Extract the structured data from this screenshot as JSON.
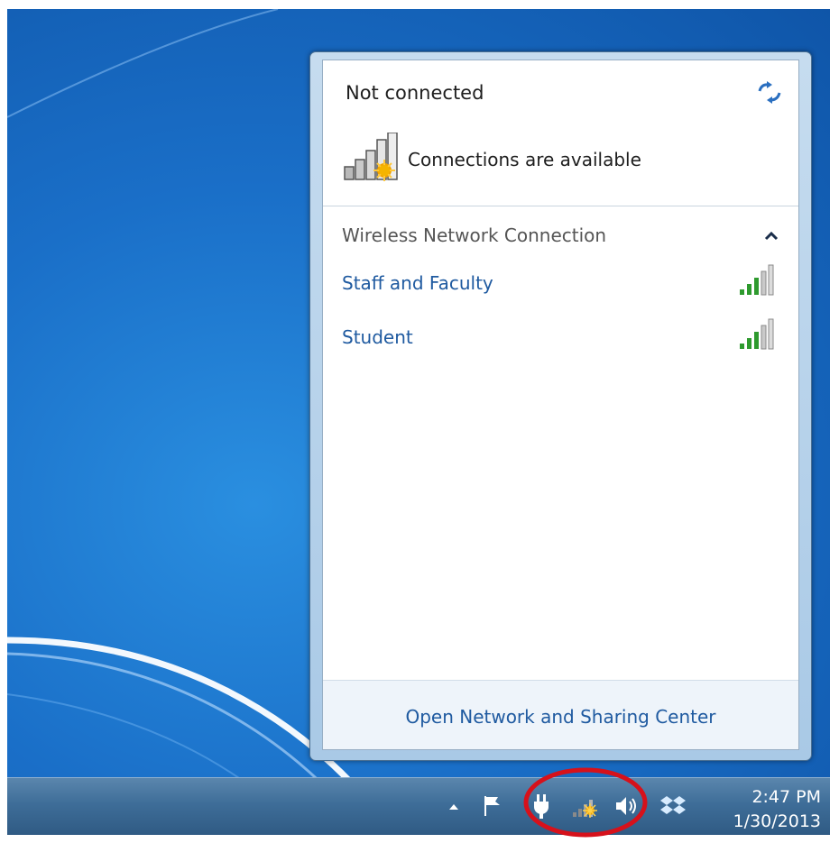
{
  "flyout": {
    "status_title": "Not connected",
    "status_subtitle": "Connections are available",
    "section_label": "Wireless Network Connection",
    "networks": [
      {
        "name": "Staff and Faculty",
        "signal_bars": 3
      },
      {
        "name": "Student",
        "signal_bars": 3
      }
    ],
    "footer_link": "Open Network and Sharing Center"
  },
  "taskbar": {
    "clock_time": "2:47 PM",
    "clock_date": "1/30/2013",
    "tray_icons": [
      "show-hidden-icons-arrow",
      "action-center-flag-icon",
      "power-plug-icon",
      "network-status-icon",
      "volume-icon",
      "dropbox-icon"
    ]
  },
  "colors": {
    "link": "#1f5aa0",
    "signal_green": "#2e9a2e",
    "warning_star": "#f2a400",
    "annotation_red": "#d6111b"
  }
}
